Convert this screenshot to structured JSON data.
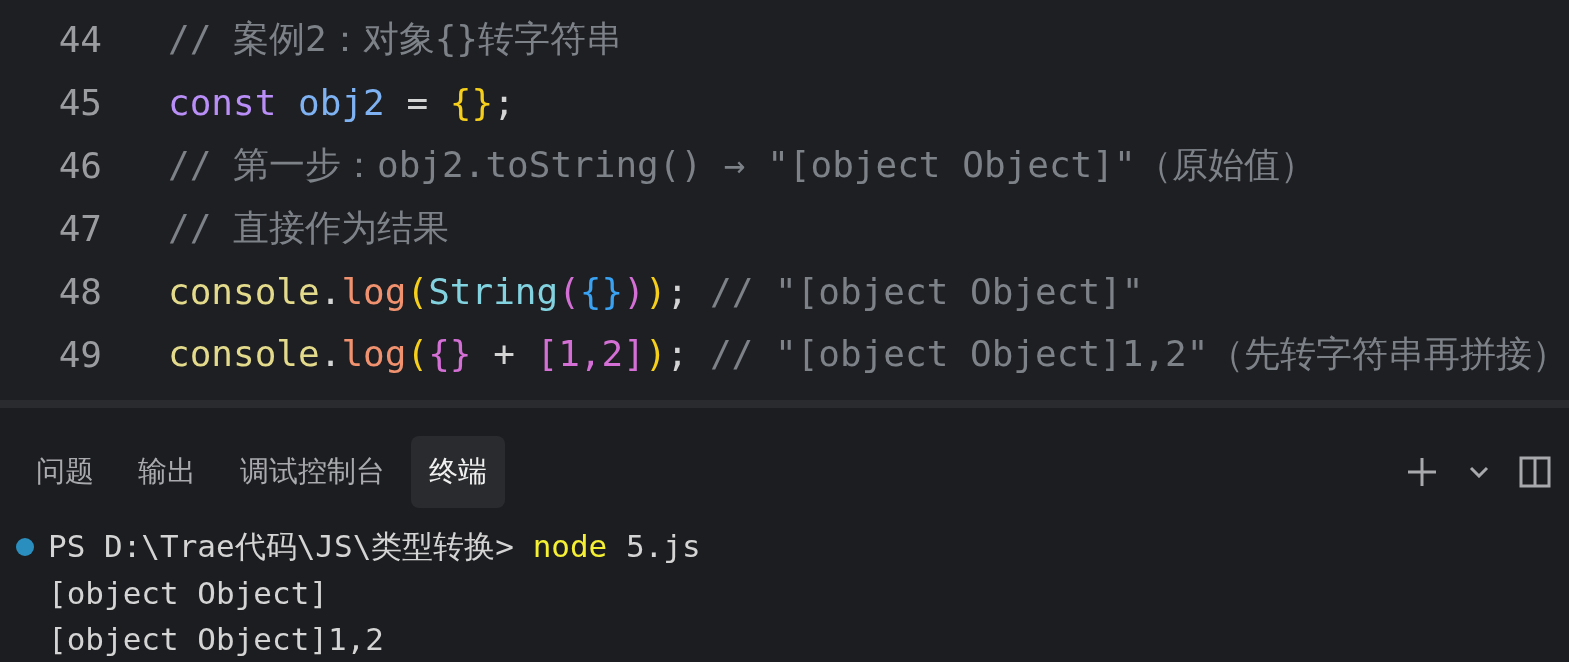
{
  "editor": {
    "lines": [
      {
        "number": "44",
        "tokens": [
          {
            "text": "// 案例2：对象{}转字符串",
            "kind": "comment"
          }
        ]
      },
      {
        "number": "45",
        "tokens": [
          {
            "text": "const",
            "kind": "keyword"
          },
          {
            "text": " obj2",
            "kind": "variable"
          },
          {
            "text": " = ",
            "kind": "plain"
          },
          {
            "text": "{}",
            "kind": "bracket1"
          },
          {
            "text": ";",
            "kind": "plain"
          }
        ]
      },
      {
        "number": "46",
        "tokens": [
          {
            "text": "// 第一步：obj2.toString() → \"[object Object]\"（原始值）",
            "kind": "comment"
          }
        ]
      },
      {
        "number": "47",
        "tokens": [
          {
            "text": "// 直接作为结果",
            "kind": "comment"
          }
        ]
      },
      {
        "number": "48",
        "tokens": [
          {
            "text": "console",
            "kind": "object"
          },
          {
            "text": ".",
            "kind": "plain"
          },
          {
            "text": "log",
            "kind": "method"
          },
          {
            "text": "(",
            "kind": "bracket1"
          },
          {
            "text": "String",
            "kind": "class"
          },
          {
            "text": "(",
            "kind": "bracket2"
          },
          {
            "text": "{}",
            "kind": "bracket3"
          },
          {
            "text": ")",
            "kind": "bracket2"
          },
          {
            "text": ")",
            "kind": "bracket1"
          },
          {
            "text": "; ",
            "kind": "plain"
          },
          {
            "text": "// \"[object Object]\"",
            "kind": "comment"
          }
        ]
      },
      {
        "number": "49",
        "tokens": [
          {
            "text": "console",
            "kind": "object"
          },
          {
            "text": ".",
            "kind": "plain"
          },
          {
            "text": "log",
            "kind": "method"
          },
          {
            "text": "(",
            "kind": "bracket1"
          },
          {
            "text": "{}",
            "kind": "bracket2"
          },
          {
            "text": " + ",
            "kind": "plain"
          },
          {
            "text": "[1,2]",
            "kind": "bracket2"
          },
          {
            "text": ")",
            "kind": "bracket1"
          },
          {
            "text": "; ",
            "kind": "plain"
          },
          {
            "text": "// \"[object Object]1,2\"（先转字符串再拼接）",
            "kind": "comment"
          }
        ]
      }
    ]
  },
  "panel": {
    "tabs": [
      {
        "label": "问题",
        "selected": false
      },
      {
        "label": "输出",
        "selected": false
      },
      {
        "label": "调试控制台",
        "selected": false
      },
      {
        "label": "终端",
        "selected": true
      }
    ]
  },
  "terminal": {
    "lines": [
      {
        "kind": "prompt",
        "tokens": [
          {
            "text": "PS D:\\Trae代码\\JS\\类型转换> ",
            "kind": "plain"
          },
          {
            "text": "node",
            "kind": "command"
          },
          {
            "text": " 5.js",
            "kind": "plain"
          }
        ]
      },
      {
        "kind": "output",
        "tokens": [
          {
            "text": "[object Object]",
            "kind": "plain"
          }
        ]
      },
      {
        "kind": "output",
        "tokens": [
          {
            "text": "[object Object]1,2",
            "kind": "plain"
          }
        ]
      }
    ]
  }
}
